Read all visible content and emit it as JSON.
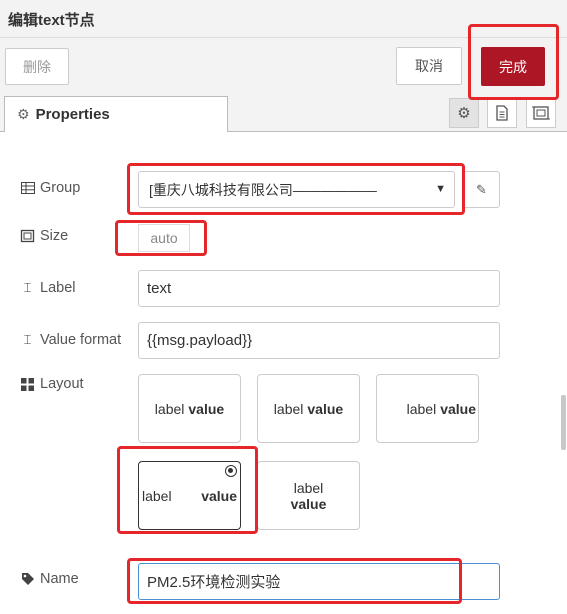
{
  "window": {
    "title": "编辑text节点"
  },
  "toolbar": {
    "delete_label": "删除",
    "cancel_label": "取消",
    "done_label": "完成"
  },
  "tabs": {
    "properties_label": "Properties"
  },
  "form": {
    "group": {
      "label": "Group",
      "value": "[重庆八城科技有限公司——————"
    },
    "size": {
      "label": "Size",
      "value": "auto"
    },
    "label_field": {
      "label": "Label",
      "value": "text"
    },
    "value_format": {
      "label": "Value format",
      "value": "{{msg.payload}}"
    },
    "layout": {
      "label": "Layout",
      "options": [
        {
          "label": "label",
          "value": "value"
        },
        {
          "label": "label",
          "value": "value"
        },
        {
          "label": "label",
          "value": "value"
        },
        {
          "label": "label",
          "value": "value",
          "selected": true
        },
        {
          "label": "label",
          "value": "value"
        }
      ]
    },
    "name": {
      "label": "Name",
      "value": "PM2.5环境检测实验"
    }
  },
  "colors": {
    "accent": "#ad1625",
    "highlight": "#e5262b",
    "focus": "#4a90d9"
  }
}
